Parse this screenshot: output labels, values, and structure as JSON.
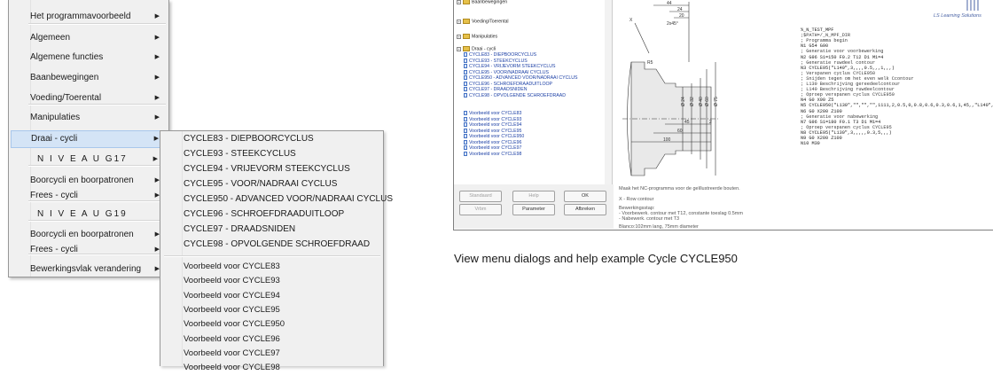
{
  "menu": {
    "items": [
      {
        "label": "Het programmavoorbeeld",
        "arrow": true
      },
      {
        "label": "Algemeen",
        "arrow": true
      },
      {
        "label": "Algemene functies",
        "arrow": true
      },
      {
        "label": "Baanbewegingen",
        "arrow": true
      },
      {
        "label": "Voeding/Toerental",
        "arrow": true
      },
      {
        "label": "Manipulaties",
        "arrow": true
      },
      {
        "label": "Draai - cycli",
        "arrow": true,
        "highlighted": true
      },
      {
        "label": "N I V E A U  G17",
        "arrow": true,
        "niveau": true
      },
      {
        "label": "Boorcycli en boorpatronen",
        "arrow": true
      },
      {
        "label": "Frees - cycli",
        "arrow": true
      },
      {
        "label": "N I V E A U  G19",
        "arrow": false,
        "niveau": true
      },
      {
        "label": "Boorcycli en boorpatronen",
        "arrow": true
      },
      {
        "label": "Frees - cycli",
        "arrow": true
      },
      {
        "label": "Bewerkingsvlak verandering",
        "arrow": true
      }
    ],
    "arrow_glyph": "▶"
  },
  "submenu": {
    "cycles": [
      "CYCLE83 - DIEPBOORCYCLUS",
      "CYCLE93 - STEEKCYCLUS",
      "CYCLE94 - VRIJEVORM STEEKCYCLUS",
      "CYCLE95 - VOOR/NADRAAI CYCLUS",
      "CYCLE950 - ADVANCED VOOR/NADRAAI CYCLUS",
      "CYCLE96 - SCHROEFDRAADUITLOOP",
      "CYCLE97 - DRAADSNIDEN",
      "CYCLE98 - OPVOLGENDE SCHROEFDRAAD"
    ],
    "examples": [
      "Voorbeeld voor CYCLE83",
      "Voorbeeld voor CYCLE93",
      "Voorbeeld voor CYCLE94",
      "Voorbeeld voor CYCLE95",
      "Voorbeeld voor CYCLE950",
      "Voorbeeld voor CYCLE96",
      "Voorbeeld voor CYCLE97",
      "Voorbeeld voor CYCLE98"
    ]
  },
  "dialog": {
    "tree": {
      "folders": [
        "Baanbewegingen",
        "Voeding/Toerental",
        "Manipulaties",
        "Draai - cycli"
      ],
      "cycles": [
        "CYCLE83 - DIEPBOORCYCLUS",
        "CYCLE93 - STEEKCYCLUS",
        "CYCLE94 - VRIJEVORM STEEKCYCLUS",
        "CYCLE95 - VOOR/NADRAAI CYCLUS",
        "CYCLE950 - ADVANCED VOOR/NADRAAI CYCLUS",
        "CYCLE96 - SCHROEFDRAADUITLOOP",
        "CYCLE97 - DRAADSNIDEN",
        "CYCLE98 - OPVOLGENDE SCHROEFDRAAD"
      ],
      "examples": [
        "Voorbeeld voor CYCLE83",
        "Voorbeeld voor CYCLE93",
        "Voorbeeld voor CYCLE94",
        "Voorbeeld voor CYCLE95",
        "Voorbeeld voor CYCLE950",
        "Voorbeeld voor CYCLE96",
        "Voorbeeld voor CYCLE97",
        "Voorbeeld voor CYCLE98"
      ]
    },
    "buttons": {
      "standaard": "Standaard",
      "help": "Help",
      "ok": "OK",
      "vrbm": "Vrbm",
      "parameter": "Parameter",
      "afbreken": "Afbreken"
    },
    "drawing": {
      "x_label": "X",
      "dims_top": [
        "44",
        "24",
        "20",
        "2x45°"
      ],
      "dims_bottom": [
        "45",
        "2",
        "60",
        "100"
      ],
      "diameters": [
        "Ø 24",
        "Ø 32",
        "Ø 40",
        "Ø 60",
        "Ø 75"
      ],
      "r_label": "R5"
    },
    "info": {
      "task": "Maak het NC-programma voor de geïllustreerde bouten.",
      "contour": "X - Row contour",
      "steps_title": "Bewerkingsstap:",
      "step1": "- Voorbewerk. contour met T12, constante toeslag 0.5mm",
      "step2": "- Nabewerk. contour met T3",
      "blank": "Blanco:102mm lang, 75mm diameter"
    },
    "brand": "LS Learning Solutions",
    "code_lines": [
      "%_N_TEST_MPF",
      ";$PATH=/_N_MPF_DIR",
      "; Programma begin",
      "N1 G54 G90",
      "; Generatie voor voorbewerking",
      "N2 G96 S1=150 F0.2 T12 D1 M1=4",
      "; Generatie ruwdeel contour",
      "N3 CYCLE95(\"L140\",3,,,,0.5,,,1,,,)",
      "; Verspanen cyclus CYCLE950",
      "; Snijden tegen om het even welk Ccontour",
      "; L130 Beschrijving gereedeelcontour",
      "; L140 Beschrijving ruwdeelcontour",
      "; Oproep verspanen cyclus CYCLE950",
      "N4 G0 X90 Z5",
      "N5 CYCLE950(\"L130\",\"\",\"\",\"\",1111,2,0.5,0,0.8,0.6,0.3,0.6,1,45,,\"L140\",\"\",\"\",\"\",...)",
      "N6 G0 X200 Z100",
      "; Generatie voor nabewerking",
      "N7 G96 S1=180 F0.1 T3 D1 M1=4",
      "; Oproep verspanen cyclus CYCLE95",
      "N8 CYCLE95(\"L130\",3,,,,,0.3,5,,,)",
      "N9 G0 X200 Z100",
      "N10 M30"
    ]
  },
  "caption": "View menu dialogs and help example Cycle CYCLE950",
  "colors": {
    "menu_bg": "#f0f0f0",
    "highlight": "#d4e4f6",
    "tree_link": "#1b3fa5",
    "brand": "#4a63a5"
  }
}
